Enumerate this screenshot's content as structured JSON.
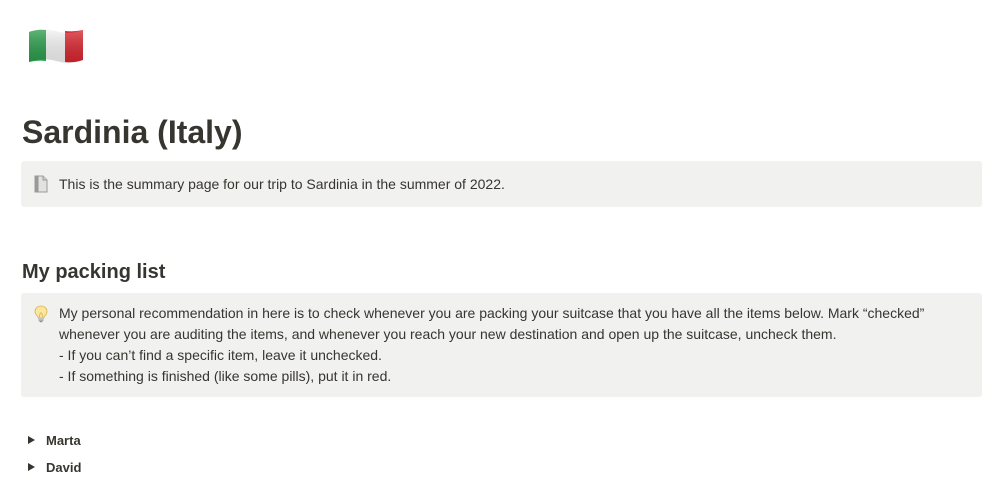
{
  "page": {
    "icon": "italy-flag-icon",
    "title": "Sardinia (Italy)"
  },
  "summary_callout": {
    "icon": "page-icon",
    "text": "This is the summary page for our trip to Sardinia in the summer of 2022."
  },
  "packing_section": {
    "heading": "My packing list",
    "tip_callout": {
      "icon": "light-bulb-icon",
      "lines": [
        "My personal recommendation in here is to check whenever you are packing your suitcase that you have all the items below. Mark “checked” whenever you are auditing the items, and whenever you reach your new destination and open up the suitcase, uncheck them.",
        "- If you can’t find a specific item, leave it unchecked.",
        "- If something is finished (like some pills), put it in red."
      ]
    },
    "toggles": [
      {
        "label": "Marta",
        "icon": "triangle-right-icon"
      },
      {
        "label": "David",
        "icon": "triangle-right-icon"
      }
    ]
  },
  "colors": {
    "text": "#37352f",
    "callout_background": "#f1f1ef",
    "flag_green": "#2a9d4b",
    "flag_white": "#f4f4f4",
    "flag_red": "#d9252f"
  }
}
